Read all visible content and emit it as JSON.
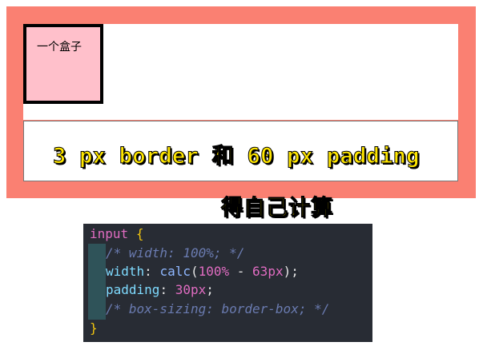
{
  "box": {
    "label": "一个盒子"
  },
  "annotations": {
    "border_padding": "3 px border 和 60 px padding",
    "calc_note": "得自己计算"
  },
  "code": {
    "selector": "input",
    "open_brace": "{",
    "close_brace": "}",
    "line1_comment": "/* width: 100%; */",
    "line2": {
      "prop": "width",
      "colon": ": ",
      "func": "calc",
      "paren_open": "(",
      "arg1": "100%",
      "minus": " - ",
      "arg2": "63px",
      "paren_close": ")",
      "semi": ";"
    },
    "line3": {
      "prop": "padding",
      "colon": ": ",
      "value": "30px",
      "semi": ";"
    },
    "line4_comment": "/* box-sizing: border-box; */"
  },
  "colors": {
    "panel_bg": "#fa8072",
    "box_bg": "#ffc0cb",
    "annotation": "#ffe600",
    "code_bg": "#282c34"
  }
}
